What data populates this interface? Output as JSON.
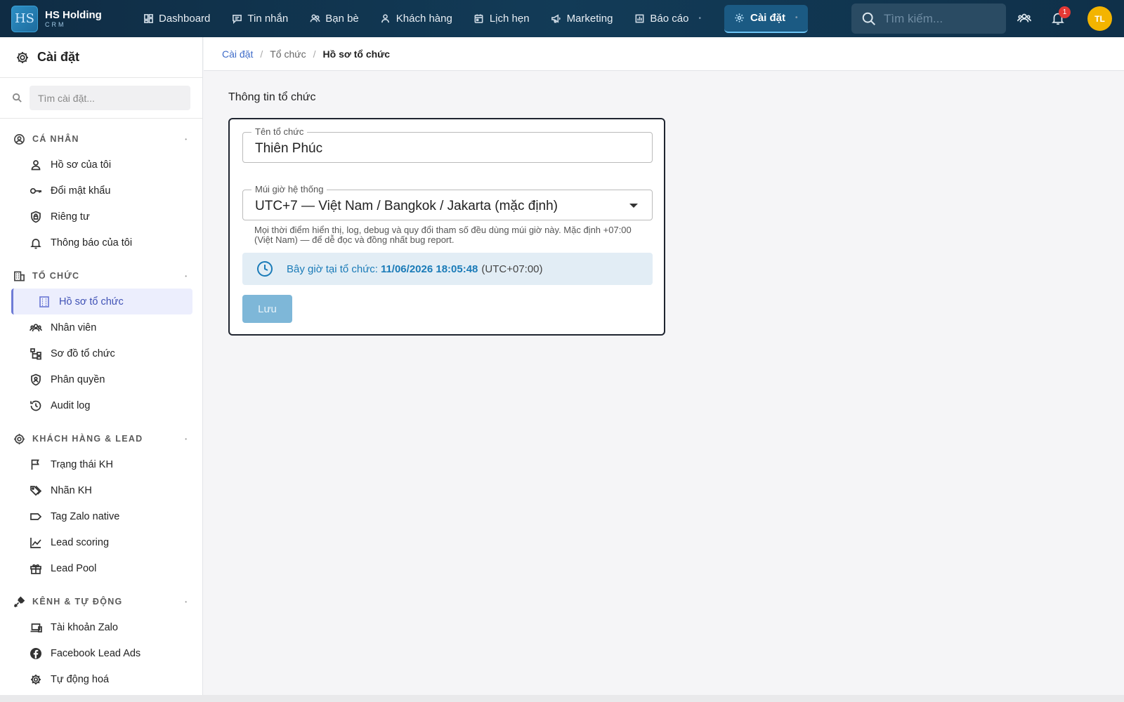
{
  "app": {
    "logo_mark": "HS",
    "name": "HS Holding",
    "sub": "CRM"
  },
  "nav": {
    "items": [
      {
        "label": "Dashboard",
        "icon": "dashboard-icon"
      },
      {
        "label": "Tin nhắn",
        "icon": "chat-icon"
      },
      {
        "label": "Bạn bè",
        "icon": "friends-icon"
      },
      {
        "label": "Khách hàng",
        "icon": "customer-icon"
      },
      {
        "label": "Lịch hẹn",
        "icon": "calendar-icon"
      },
      {
        "label": "Marketing",
        "icon": "megaphone-icon"
      },
      {
        "label": "Báo cáo",
        "icon": "report-icon"
      },
      {
        "label": "Cài đặt",
        "icon": "gear-icon",
        "active": true
      }
    ],
    "search_placeholder": "Tìm kiếm...",
    "notification_count": "1",
    "avatar_initials": "TL"
  },
  "sidebar": {
    "title": "Cài đặt",
    "search_placeholder": "Tìm cài đặt...",
    "sections": [
      {
        "label": "CÁ NHÂN",
        "icon": "user-circle-icon",
        "items": [
          {
            "label": "Hồ sơ của tôi",
            "icon": "person-icon"
          },
          {
            "label": "Đổi mật khẩu",
            "icon": "key-icon"
          },
          {
            "label": "Riêng tư",
            "icon": "shield-lock-icon"
          },
          {
            "label": "Thông báo của tôi",
            "icon": "bell-icon"
          }
        ]
      },
      {
        "label": "TỔ CHỨC",
        "icon": "building-icon",
        "items": [
          {
            "label": "Hồ sơ tổ chức",
            "icon": "building-grid-icon",
            "active": true
          },
          {
            "label": "Nhân viên",
            "icon": "group-icon"
          },
          {
            "label": "Sơ đồ tổ chức",
            "icon": "org-chart-icon"
          },
          {
            "label": "Phân quyền",
            "icon": "shield-user-icon"
          },
          {
            "label": "Audit log",
            "icon": "history-icon"
          }
        ]
      },
      {
        "label": "KHÁCH HÀNG & LEAD",
        "icon": "target-icon",
        "items": [
          {
            "label": "Trạng thái KH",
            "icon": "flag-icon"
          },
          {
            "label": "Nhãn KH",
            "icon": "tags-icon"
          },
          {
            "label": "Tag Zalo native",
            "icon": "label-icon"
          },
          {
            "label": "Lead scoring",
            "icon": "chart-line-icon"
          },
          {
            "label": "Lead Pool",
            "icon": "gift-icon"
          }
        ]
      },
      {
        "label": "KÊNH & TỰ ĐỘNG",
        "icon": "plug-icon",
        "items": [
          {
            "label": "Tài khoản Zalo",
            "icon": "devices-icon"
          },
          {
            "label": "Facebook Lead Ads",
            "icon": "facebook-icon"
          },
          {
            "label": "Tự động hoá",
            "icon": "cog-auto-icon"
          }
        ]
      }
    ]
  },
  "breadcrumb": {
    "root": "Cài đặt",
    "mid": "Tổ chức",
    "current": "Hồ sơ tổ chức"
  },
  "form": {
    "section_title": "Thông tin tổ chức",
    "org_name_label": "Tên tổ chức",
    "org_name_value": "Thiên Phúc",
    "timezone_label": "Múi giờ hệ thống",
    "timezone_value": "UTC+7 — Việt Nam / Bangkok / Jakarta (mặc định)",
    "helper": "Mọi thời điểm hiển thị, log, debug và quy đổi tham số đều dùng múi giờ này. Mặc định +07:00 (Việt Nam) — để dễ đọc và đồng nhất bug report.",
    "now_label": "Bây giờ tại tổ chức:",
    "now_value": "11/06/2026 18:05:48",
    "now_tz": "(UTC+07:00)",
    "save_label": "Lưu"
  },
  "colors": {
    "topbar": "#0f2c44",
    "accent": "#6f7cd6",
    "save_button": "#7eb7d8",
    "time_text": "#1a7bb8"
  }
}
